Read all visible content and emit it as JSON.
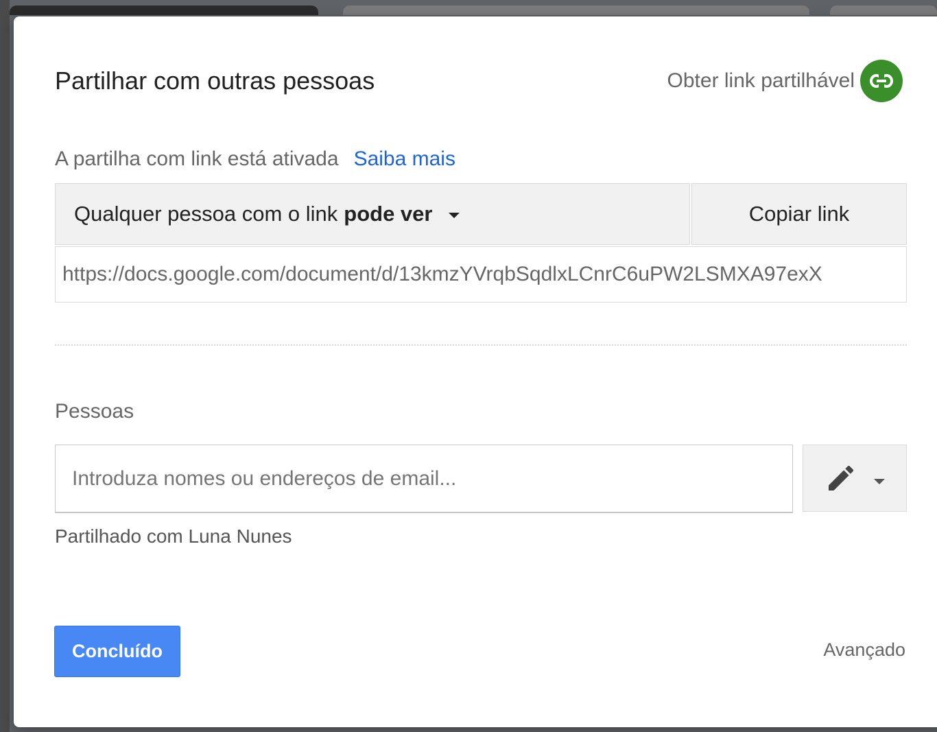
{
  "dialog": {
    "title": "Partilhar com outras pessoas",
    "get_link": {
      "label": "Obter link partilhável",
      "icon": "link-icon",
      "color": "#3a8f2a"
    },
    "link_sharing": {
      "status": "A partilha com link está ativada",
      "learn_more": "Saiba mais",
      "access_prefix": "Qualquer pessoa com o link",
      "access_level": "pode ver",
      "copy_link": "Copiar link",
      "url": "https://docs.google.com/document/d/13kmzYVrqbSqdlxLCnrC6uPW2LSMXA97exX"
    },
    "people": {
      "label": "Pessoas",
      "input_placeholder": "Introduza nomes ou endereços de email...",
      "permission_icon": "pencil-icon",
      "shared_with": "Partilhado com Luna Nunes"
    },
    "footer": {
      "done": "Concluído",
      "advanced": "Avançado"
    },
    "colors": {
      "primary_button": "#4788f4",
      "link": "#1a66d6"
    }
  }
}
